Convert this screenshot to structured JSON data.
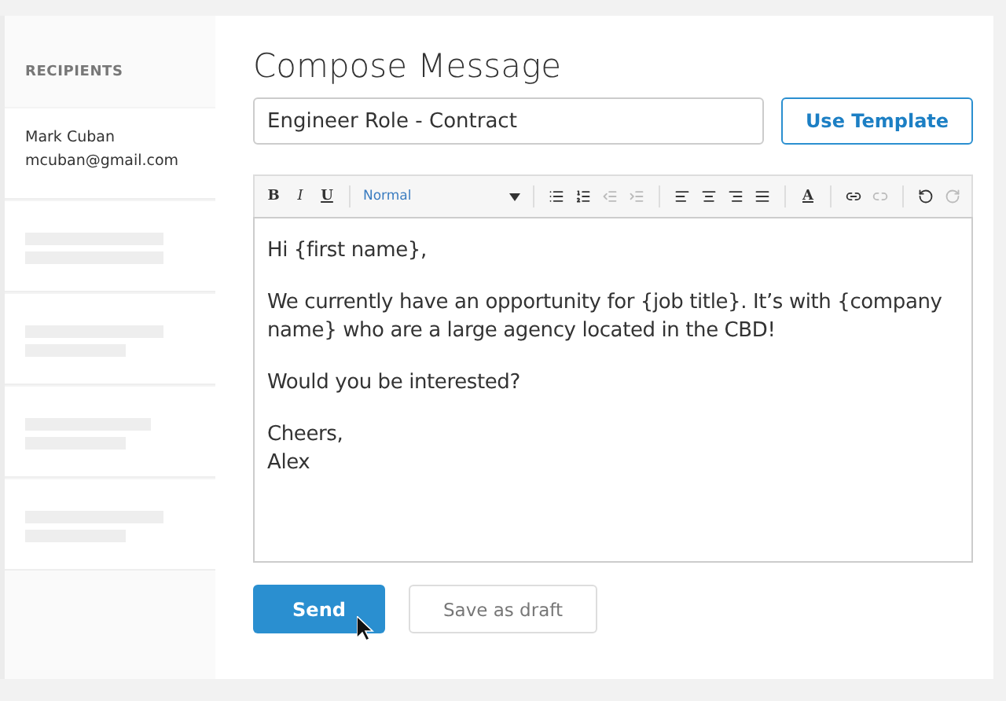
{
  "sidebar": {
    "heading": "RECIPIENTS",
    "recipients": [
      {
        "kind": "contact",
        "name": "Mark Cuban",
        "email": "mcuban@gmail.com"
      },
      {
        "kind": "placeholder"
      },
      {
        "kind": "placeholder"
      },
      {
        "kind": "placeholder"
      },
      {
        "kind": "placeholder"
      }
    ]
  },
  "compose": {
    "title": "Compose Message",
    "subject": "Engineer Role - Contract",
    "template_button": "Use Template",
    "toolbar": [
      {
        "kind": "bold",
        "label": "B",
        "disabled": false
      },
      {
        "kind": "italic",
        "label": "I",
        "disabled": false
      },
      {
        "kind": "underline",
        "label": "U",
        "disabled": false
      },
      {
        "kind": "separator"
      },
      {
        "kind": "dropdown",
        "label": "Normal"
      },
      {
        "kind": "separator"
      },
      {
        "kind": "bullets",
        "disabled": false
      },
      {
        "kind": "numbers",
        "disabled": false
      },
      {
        "kind": "outdent",
        "disabled": true
      },
      {
        "kind": "indent",
        "disabled": true
      },
      {
        "kind": "separator"
      },
      {
        "kind": "align-left",
        "disabled": false
      },
      {
        "kind": "align-center",
        "disabled": false
      },
      {
        "kind": "align-right",
        "disabled": false
      },
      {
        "kind": "justify",
        "disabled": false
      },
      {
        "kind": "separator"
      },
      {
        "kind": "color",
        "label": "A",
        "disabled": false
      },
      {
        "kind": "separator"
      },
      {
        "kind": "link",
        "disabled": false
      },
      {
        "kind": "unlink",
        "disabled": true
      },
      {
        "kind": "separator"
      },
      {
        "kind": "undo",
        "disabled": false
      },
      {
        "kind": "redo",
        "disabled": true
      }
    ],
    "body": [
      "Hi {first name},",
      "We currently have an opportunity for {job title}. It’s with {company name} who are a large agency located in the CBD!",
      "Would you be interested?",
      "Cheers,\nAlex"
    ],
    "send_button": "Send",
    "draft_button": "Save as draft"
  }
}
